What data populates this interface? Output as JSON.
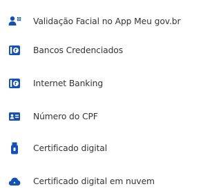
{
  "colors": {
    "icon": "#1351B4",
    "text": "#333333",
    "background": "#FFFFFF"
  },
  "login_options": [
    {
      "label": "Validação Facial no App Meu gov.br",
      "icon": "face-recognition-icon"
    },
    {
      "label": "Bancos Credenciados",
      "icon": "bank-icon"
    },
    {
      "label": "Internet Banking",
      "icon": "bank-icon"
    },
    {
      "label": "Número do CPF",
      "icon": "id-card-icon"
    },
    {
      "label": "Certificado digital",
      "icon": "usb-token-icon"
    },
    {
      "label": "Certificado digital em nuvem",
      "icon": "cloud-certificate-icon"
    }
  ]
}
